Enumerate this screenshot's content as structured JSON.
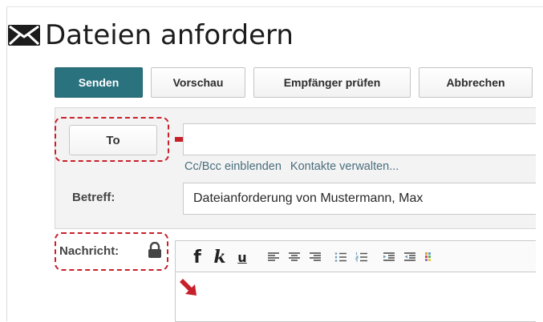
{
  "title": "Dateien anfordern",
  "toolbar": {
    "send_label": "Senden",
    "preview_label": "Vorschau",
    "check_recipients_label": "Empfänger prüfen",
    "cancel_label": "Abbrechen"
  },
  "form": {
    "to_button_label": "To",
    "to_value": "",
    "cc_bcc_link": "Cc/Bcc einblenden",
    "contacts_link": "Kontakte verwalten...",
    "subject_label": "Betreff:",
    "subject_value": "Dateianforderung von Mustermann, Max",
    "message_label": "Nachricht:"
  },
  "editor": {
    "bold_label": "f",
    "italic_label": "k",
    "underline_label": "u",
    "body_text": ""
  },
  "colors": {
    "accent": "#29727e",
    "highlight": "#c7202a",
    "link": "#4a6e7e"
  },
  "icons": [
    "envelope-icon",
    "lock-icon",
    "red-arrow-right",
    "red-arrow-down-right"
  ]
}
